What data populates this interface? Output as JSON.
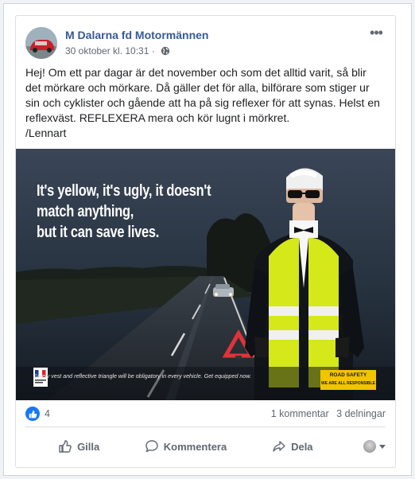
{
  "post": {
    "page_name": "M Dalarna fd Motormännen",
    "timestamp": "30 oktober kl. 10:31 ·",
    "body_lines": [
      "Hej! Om ett par dagar är det november och som det alltid varit, så blir det mörkare och mörkare. Då gäller det för alla, bilförare som stiger ur sin och cyklister och gående att ha på sig reflexer för att synas. Helst en reflexväst. REFLEXERA mera och kör lugnt i mörkret.",
      "/Lennart"
    ],
    "more_icon": "more-horizontal-icon",
    "audience_icon": "globe-icon"
  },
  "image": {
    "headline_line1": "It's yellow, it's ugly, it doesn't match anything,",
    "headline_line2": "but it can save lives.",
    "footer_text": "Safety vest and reflective triangle will be obligatory in every vehicle. Get equipped now.",
    "badge_line1": "ROAD SAFETY",
    "badge_line2": "WE ARE ALL RESPONSIBLE"
  },
  "stats": {
    "likes": "4",
    "comments": "1 kommentar",
    "shares": "3 delningar"
  },
  "actions": {
    "like": "Gilla",
    "comment": "Kommentera",
    "share": "Dela"
  },
  "colors": {
    "link": "#385898",
    "accent": "#1877f2",
    "vest": "#d4e81a",
    "badge": "#f3c300"
  }
}
